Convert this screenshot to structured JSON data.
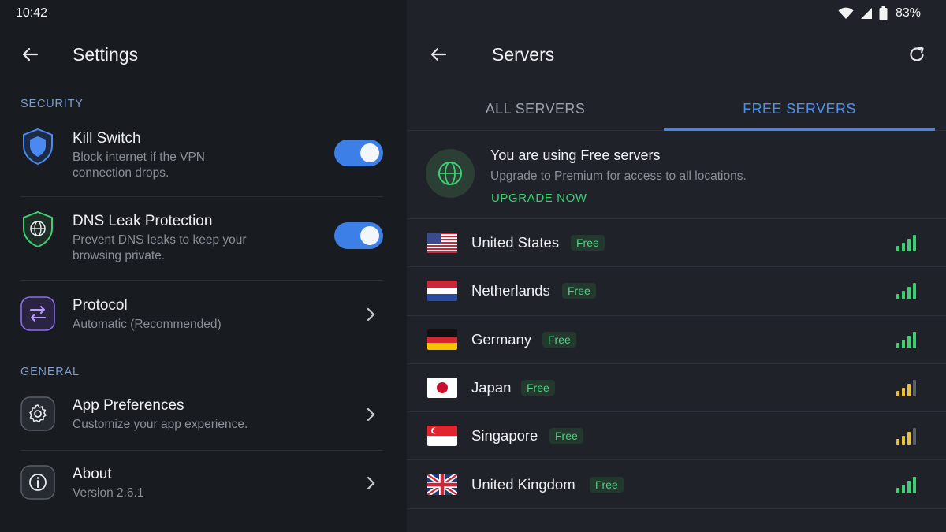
{
  "status_bar": {
    "time": "10:42",
    "battery": "83%"
  },
  "left": {
    "title": "Settings",
    "security_label": "SECURITY",
    "general_label": "GENERAL",
    "kill_switch": {
      "title": "Kill Switch",
      "sub1": "Block internet if the VPN",
      "sub2": "connection drops.",
      "enabled": true
    },
    "dns": {
      "title": "DNS Leak Protection",
      "sub1": "Prevent DNS leaks to keep your",
      "sub2": "browsing private.",
      "enabled": true
    },
    "protocol": {
      "title": "Protocol",
      "sub": "Automatic (Recommended)"
    },
    "app_prefs": {
      "title": "App Preferences",
      "sub": "Customize your app experience."
    },
    "about": {
      "title": "About",
      "sub": "Version 2.6.1"
    }
  },
  "right": {
    "title": "Servers",
    "tabs": {
      "all": "ALL SERVERS",
      "free": "FREE SERVERS",
      "active": "free"
    },
    "banner": {
      "title": "You are using Free servers",
      "sub": "Upgrade to Premium for access to all locations.",
      "cta": "UPGRADE NOW"
    },
    "servers": [
      {
        "country": "United States",
        "badge": "Free",
        "signal": 4
      },
      {
        "country": "Netherlands",
        "badge": "Free",
        "signal": 4
      },
      {
        "country": "Germany",
        "badge": "Free",
        "signal": 4
      },
      {
        "country": "Japan",
        "badge": "Free",
        "signal": 3
      },
      {
        "country": "Singapore",
        "badge": "Free",
        "signal": 3
      },
      {
        "country": "United Kingdom",
        "badge": "Free",
        "signal": 4
      }
    ]
  },
  "colors": {
    "accent_blue": "#3c7fe6",
    "signal_green": "#3fcf72",
    "signal_yellow": "#e8c23a",
    "signal_gray": "#5b6069"
  },
  "icons": {
    "back": "arrow-left-icon",
    "refresh": "refresh-icon",
    "wifi": "wifi-icon",
    "cell": "cell-signal-icon",
    "battery": "battery-icon"
  }
}
